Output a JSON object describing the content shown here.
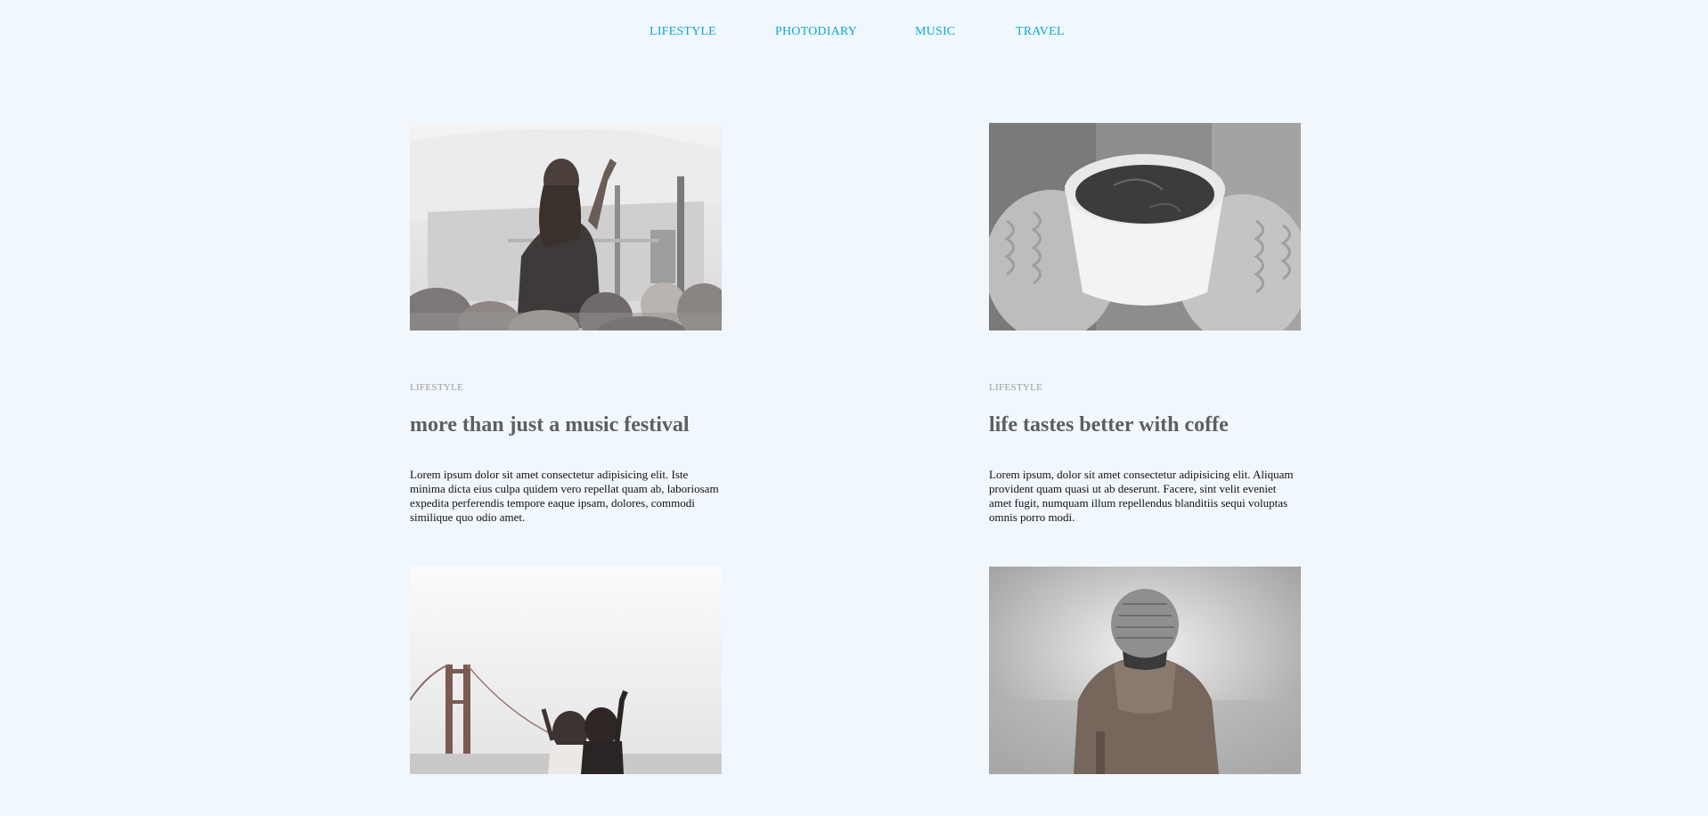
{
  "nav": {
    "items": [
      {
        "label": "LIFESTYLE"
      },
      {
        "label": "PHOTODIARY"
      },
      {
        "label": "MUSIC"
      },
      {
        "label": "TRAVEL"
      }
    ]
  },
  "posts": [
    {
      "category": "LIFESTYLE",
      "title": "more than just a music festival",
      "excerpt": "Lorem ipsum dolor sit amet consectetur adipisicing elit. Iste minima dicta eius culpa quidem vero repellat quam ab, laboriosam expedita perferendis tempore eaque ipsam, dolores, commodi similique quo odio amet."
    },
    {
      "category": "LIFESTYLE",
      "title": "life tastes better with coffe",
      "excerpt": "Lorem ipsum, dolor sit amet consectetur adipisicing elit. Aliquam provident quam quasi ut ab deserunt. Facere, sint velit eveniet amet fugit, numquam illum repellendus blanditiis sequi voluptas omnis porro modi."
    }
  ],
  "colors": {
    "background": "#f0f8fe",
    "nav_link": "#16a5cf",
    "category": "#9a9a9a",
    "title": "#5e5e5e"
  }
}
